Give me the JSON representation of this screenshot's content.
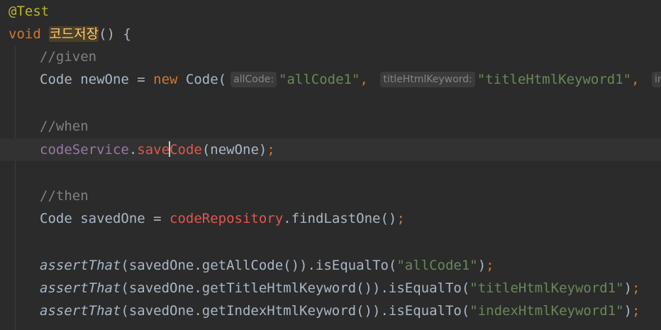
{
  "annotation": "@Test",
  "method": {
    "return_type": "void",
    "name": "코드저장",
    "signature_tail": "() {"
  },
  "comments": {
    "given": "//given",
    "when": "//when",
    "then": "//then"
  },
  "given_line": {
    "type": "Code",
    "var": " newOne = ",
    "new_kw": "new",
    "ctor": " Code(",
    "hint1": "allCode:",
    "arg1": "\"allCode1\"",
    "comma1": ",",
    "hint2": "titleHtmlKeyword:",
    "arg2": "\"titleHtmlKeyword1\"",
    "comma2": ",",
    "hint3": "inc"
  },
  "when_line": {
    "field": "codeService",
    "dot": ".",
    "method_before_caret": "save",
    "method_after_caret": "Code",
    "args": "(newOne)",
    "semi": ";"
  },
  "then_line": {
    "type_var": "Code savedOne = ",
    "field": "codeRepository",
    "call": ".findLastOne()",
    "semi": ";"
  },
  "asserts": [
    {
      "fn": "assertThat",
      "inner": "(savedOne.getAllCode()).isEqualTo(",
      "value": "\"allCode1\"",
      "close": ")",
      "semi": ";"
    },
    {
      "fn": "assertThat",
      "inner": "(savedOne.getTitleHtmlKeyword()).isEqualTo(",
      "value": "\"titleHtmlKeyword1\"",
      "close": ")",
      "semi": ";"
    },
    {
      "fn": "assertThat",
      "inner": "(savedOne.getIndexHtmlKeyword()).isEqualTo(",
      "value": "\"indexHtmlKeyword1\"",
      "close": ")",
      "semi": ";"
    }
  ],
  "colors": {
    "background": "#2b2b2b",
    "current_line": "#323232",
    "keyword": "#cc7832",
    "string": "#6a8759",
    "comment": "#808080",
    "annotation": "#bbb529",
    "method_decl": "#ffc66d",
    "field": "#9876aa",
    "unresolved": "#e0564e"
  }
}
